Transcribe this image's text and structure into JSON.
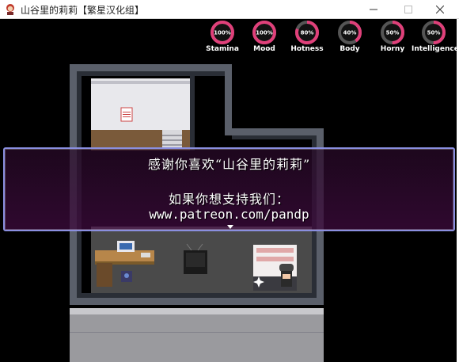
{
  "window": {
    "title": "山谷里的莉莉【繁星汉化组】",
    "icon": "app-character-icon",
    "controls": [
      "minimize",
      "maximize",
      "close"
    ]
  },
  "stats": [
    {
      "label": "Stamina",
      "value_text": "100%",
      "value": 100,
      "color": "#e0407a"
    },
    {
      "label": "Mood",
      "value_text": "100%",
      "value": 100,
      "color": "#e0407a"
    },
    {
      "label": "Hotness",
      "value_text": "80%",
      "value": 80,
      "color": "#e0407a"
    },
    {
      "label": "Body",
      "value_text": "40%",
      "value": 40,
      "color": "#e0407a"
    },
    {
      "label": "Horny",
      "value_text": "50%",
      "value": 50,
      "color": "#e0407a"
    },
    {
      "label": "Intelligence",
      "value_text": "50%",
      "value": 50,
      "color": "#e0407a"
    }
  ],
  "message": {
    "line1": "感谢你喜欢“山谷里的莉莉”",
    "line2": "如果你想支持我们：",
    "line3": "www.patreon.com/pandp",
    "border_color": "#8a8fe0"
  }
}
